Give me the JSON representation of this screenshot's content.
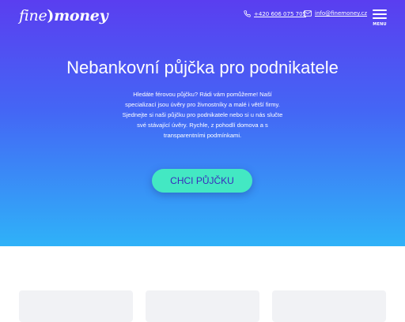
{
  "header": {
    "logo": {
      "part1": "fine",
      "part2": ")",
      "part3": "money"
    },
    "phone": {
      "icon": "phone-icon",
      "text": "+420 606 075 705"
    },
    "email": {
      "icon": "envelope-icon",
      "text": "info@finemoney.cz"
    },
    "menu": {
      "icon": "hamburger-icon",
      "label": "MENU"
    }
  },
  "hero": {
    "title": "Nebankovní půjčka pro podnikatele",
    "description_lines": [
      "Hledáte férovou půjčku? Rádi vám pomůžeme! Naší",
      "specializací jsou úvěry pro živnostníky a malé i větší firmy.",
      "Sjednejte si naši půjčku pro podnikatele nebo si u nás slučte",
      "své stávající úvěry. Rychle, z pohodlí domova a s",
      "transparentními podmínkami."
    ],
    "cta_label": "CHCI PŮJČKU"
  },
  "colors": {
    "gradient_top": "#5a3ef0",
    "gradient_bottom": "#2fb2f8",
    "cta_background": "#43e8c3",
    "cta_text": "#3a2bbd",
    "card_background": "#f1f2f5"
  }
}
